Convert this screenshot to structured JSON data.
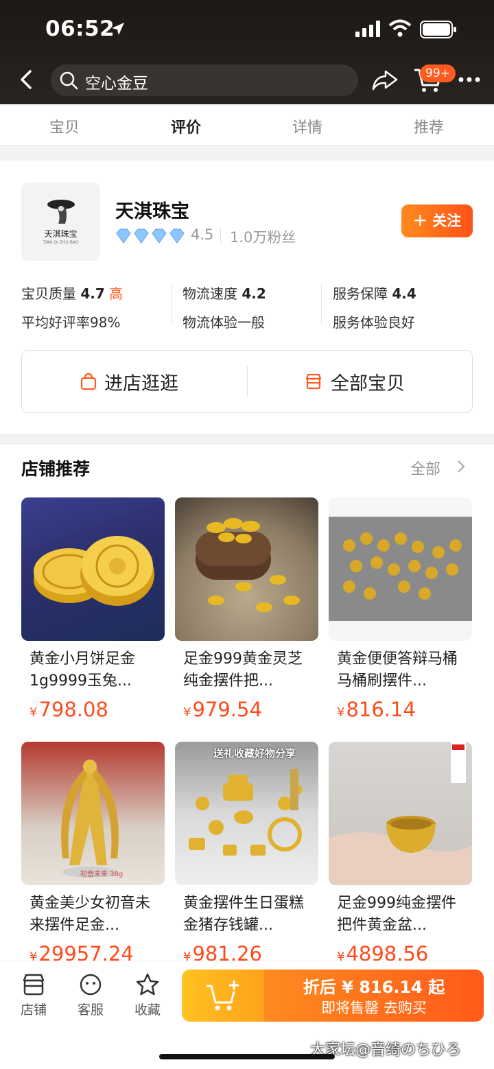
{
  "status_bar": {
    "time": "06:52"
  },
  "header": {
    "search_text": "空心金豆",
    "cart_badge": "99+"
  },
  "tabs": [
    {
      "label": "宝贝",
      "active": false
    },
    {
      "label": "评价",
      "active": true
    },
    {
      "label": "详情",
      "active": false
    },
    {
      "label": "推荐",
      "active": false
    }
  ],
  "store": {
    "logo_text": "天淇珠宝",
    "logo_subtext": "TIAN QI ZHU BAO",
    "name": "天淇珠宝",
    "diamond_count": 4,
    "rating": "4.5",
    "fans": "1.0万粉丝",
    "follow_label": "关注",
    "metrics": [
      {
        "label": "宝贝质量",
        "score": "4.7",
        "level": "高",
        "sub": "平均好评率98%"
      },
      {
        "label": "物流速度",
        "score": "4.2",
        "level": "",
        "sub": "物流体验一般"
      },
      {
        "label": "服务保障",
        "score": "4.4",
        "level": "",
        "sub": "服务体验良好"
      }
    ],
    "enter_store_label": "进店逛逛",
    "all_items_label": "全部宝贝"
  },
  "recommend": {
    "title": "店铺推荐",
    "all_label": "全部",
    "items": [
      {
        "name": "黄金小月饼足金1g9999玉兔...",
        "currency": "¥",
        "price": "798.08"
      },
      {
        "name": "足金999黄金灵芝纯金摆件把...",
        "currency": "¥",
        "price": "979.54"
      },
      {
        "name": "黄金便便答辩马桶马桶刷摆件...",
        "currency": "¥",
        "price": "816.14"
      },
      {
        "name": "黄金美少女初音未来摆件足金...",
        "currency": "¥",
        "price": "29957.24"
      },
      {
        "name": "黄金摆件生日蛋糕金猪存钱罐...",
        "currency": "¥",
        "price": "981.26"
      },
      {
        "name": "足金999纯金摆件把件黄金盆...",
        "currency": "¥",
        "price": "4898.56"
      }
    ],
    "image_texts": {
      "figure_caption": "初音未来 38g",
      "gift_banner": "送礼收藏好物分享"
    }
  },
  "bottom_bar": {
    "nav": [
      {
        "label": "店铺",
        "icon": "store-icon"
      },
      {
        "label": "客服",
        "icon": "service-icon"
      },
      {
        "label": "收藏",
        "icon": "star-icon"
      }
    ],
    "buy_line1": "折后 ¥ 816.14 起",
    "buy_line2": "即将售罄  去购买"
  },
  "watermark": "大家坛@音绮のちひろ",
  "colors": {
    "accent": "#ff5a1f",
    "price": "#ff4a1a",
    "gold": "#e8b923"
  }
}
